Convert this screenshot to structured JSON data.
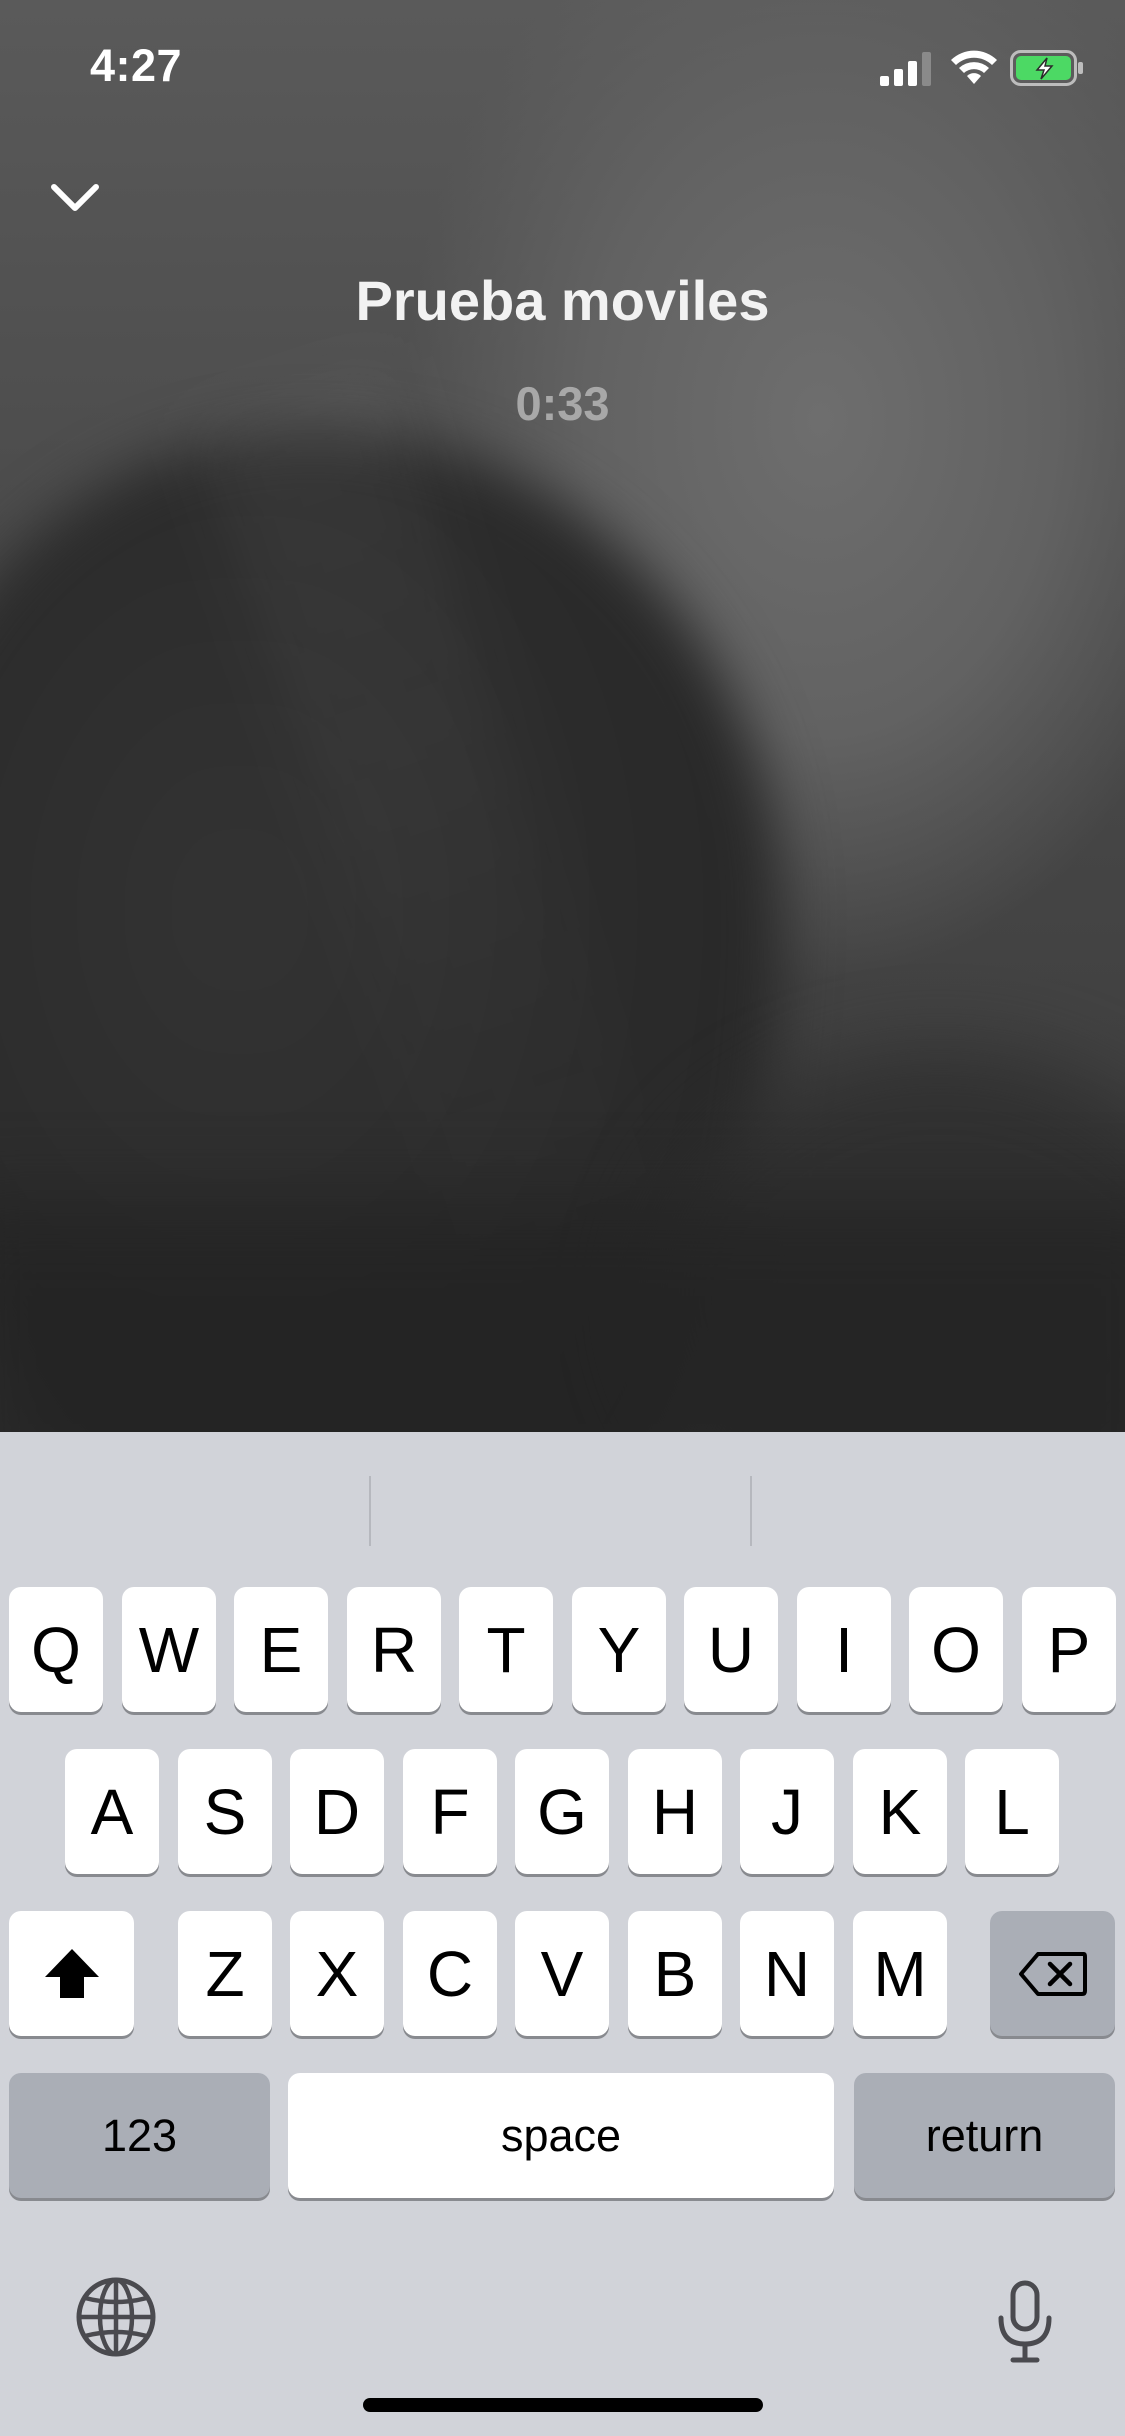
{
  "status_bar": {
    "time": "4:27"
  },
  "call": {
    "name": "Prueba moviles",
    "duration": "0:33"
  },
  "keyboard": {
    "row1": [
      "Q",
      "W",
      "E",
      "R",
      "T",
      "Y",
      "U",
      "I",
      "O",
      "P"
    ],
    "row2": [
      "A",
      "S",
      "D",
      "F",
      "G",
      "H",
      "J",
      "K",
      "L"
    ],
    "row3": [
      "Z",
      "X",
      "C",
      "V",
      "B",
      "N",
      "M"
    ],
    "numbers_label": "123",
    "space_label": "space",
    "return_label": "return"
  },
  "icons": {
    "collapse": "chevron-down-icon",
    "shift": "shift-icon",
    "delete": "backspace-icon",
    "globe": "globe-icon",
    "mic": "microphone-icon",
    "signal": "cellular-signal-icon",
    "wifi": "wifi-icon",
    "battery": "battery-charging-icon"
  },
  "colors": {
    "keyboard_bg": "#d1d3d9",
    "key_light": "#ffffff",
    "key_dark": "#aaaeb6",
    "battery_fill": "#4cd964"
  }
}
